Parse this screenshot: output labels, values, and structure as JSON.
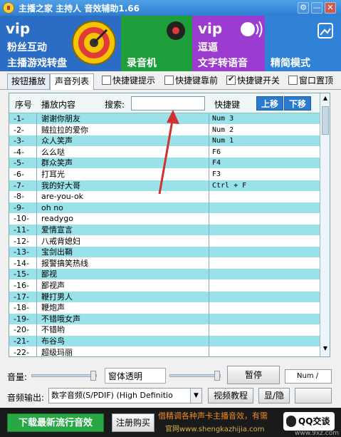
{
  "window": {
    "title": "主播之家 主持人 音效辅助1.66"
  },
  "window_controls": {
    "settings": "⚙",
    "minimize": "—",
    "close": "✕"
  },
  "banners": [
    {
      "vip": "vip",
      "line1": "粉丝互动",
      "line2": "主播游戏转盘"
    },
    {
      "line2": "录音机"
    },
    {
      "vip": "vip",
      "line1": "逗逼",
      "line2": "文字转语音"
    },
    {
      "line2": "精简模式"
    }
  ],
  "tabs": [
    "按钮播放",
    "声音列表"
  ],
  "options": [
    {
      "label": "快捷键提示",
      "checked": false
    },
    {
      "label": "快捷键靠前",
      "checked": false
    },
    {
      "label": "快捷键开关",
      "checked": true
    },
    {
      "label": "窗口置顶",
      "checked": false
    }
  ],
  "list": {
    "col_no": "序号",
    "col_content": "播放内容",
    "search_label": "搜索:",
    "search_value": "",
    "col_hotkey": "快捷键",
    "btn_up": "上移",
    "btn_down": "下移",
    "rows": [
      {
        "no": "-1-",
        "name": "谢谢你朋友",
        "key": "Num 3"
      },
      {
        "no": "-2-",
        "name": "贼拉拉的爱你",
        "key": "Num 2"
      },
      {
        "no": "-3-",
        "name": "众人笑声",
        "key": "Num 1"
      },
      {
        "no": "-4-",
        "name": "么么哒",
        "key": "F6"
      },
      {
        "no": "-5-",
        "name": "群众笑声",
        "key": "F4"
      },
      {
        "no": "-6-",
        "name": "打耳光",
        "key": "F3"
      },
      {
        "no": "-7-",
        "name": "我的好大哥",
        "key": "Ctrl + F"
      },
      {
        "no": "-8-",
        "name": "are-you-ok",
        "key": ""
      },
      {
        "no": "-9-",
        "name": "oh no",
        "key": ""
      },
      {
        "no": "-10-",
        "name": "readygo",
        "key": ""
      },
      {
        "no": "-11-",
        "name": "爱情宣言",
        "key": ""
      },
      {
        "no": "-12-",
        "name": "八戒背媳妇",
        "key": ""
      },
      {
        "no": "-13-",
        "name": "宝剑出鞘",
        "key": ""
      },
      {
        "no": "-14-",
        "name": "报警搞笑热线",
        "key": ""
      },
      {
        "no": "-15-",
        "name": "鄙视",
        "key": ""
      },
      {
        "no": "-16-",
        "name": "鄙视声",
        "key": ""
      },
      {
        "no": "-17-",
        "name": "鞭打男人",
        "key": ""
      },
      {
        "no": "-18-",
        "name": "鞭炮声",
        "key": ""
      },
      {
        "no": "-19-",
        "name": "不错哦女声",
        "key": ""
      },
      {
        "no": "-20-",
        "name": "不错哟",
        "key": ""
      },
      {
        "no": "-21-",
        "name": "布谷鸟",
        "key": ""
      },
      {
        "no": "-22-",
        "name": "超级玛丽",
        "key": ""
      }
    ]
  },
  "controls": {
    "volume_label": "音量:",
    "transparency_label": "窗体透明",
    "pause_button": "暂停",
    "status_box": "Num /",
    "output_label": "音频输出:",
    "output_value": "数字音频(S/PDIF) (High Definitio",
    "video_tutorial": "视频教程",
    "show_hide": "显/隐"
  },
  "footer": {
    "download_button": "下载最新流行音效",
    "register_button": "注册购买",
    "promo_text": "借精调各种声卡主播音效，有需",
    "promo_site": "官网www.shengkazhijia.com",
    "qq_button": "QQ交谈",
    "watermark": "www.9xz.com"
  }
}
